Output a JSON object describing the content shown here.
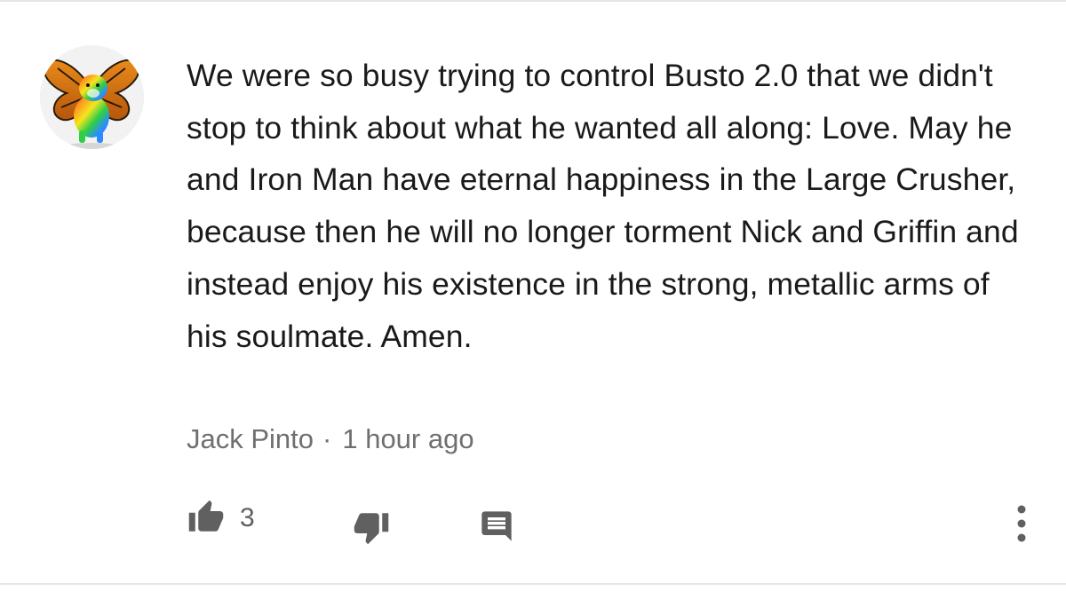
{
  "comment": {
    "text": "We were so busy trying to control Busto 2.0 that we didn't stop to think about what he wanted all along: Love. May he and Iron Man have eternal happiness in the Large Crusher, because then he will no longer torment Nick and Griffin and instead enjoy his existence in the strong, metallic arms of his soulmate. Amen.",
    "author": "Jack Pinto",
    "separator": "·",
    "timestamp": "1 hour ago",
    "avatar": "rainbow-dog-with-butterfly-wings-avatar"
  },
  "actions": {
    "like_count": "3",
    "like_icon": "thumbs-up-icon",
    "dislike_icon": "thumbs-down-icon",
    "reply_icon": "reply-comment-icon",
    "more_icon": "more-vertical-icon"
  },
  "colors": {
    "text": "#1a1a1a",
    "meta": "#6f6f6f",
    "icon": "#606060",
    "divider": "#e6e6e6"
  }
}
